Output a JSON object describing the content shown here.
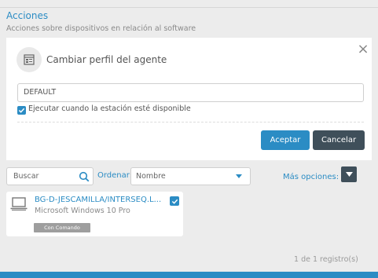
{
  "section": {
    "title": "Acciones",
    "subtitle": "Acciones sobre dispositivos en relación al software"
  },
  "dialog": {
    "title": "Cambiar perfil del agente",
    "close_icon": "close-icon",
    "profile_value": "DEFAULT",
    "checkbox_checked": true,
    "checkbox_label": "Ejecutar cuando la estación esté disponible",
    "accept_label": "Aceptar",
    "cancel_label": "Cancelar"
  },
  "toolbar": {
    "search_placeholder": "Buscar",
    "order_label": "Ordenar:",
    "order_value": "Nombre",
    "more_options_label": "Más opciones:"
  },
  "devices": [
    {
      "name": "BG-D-JESCAMILLA/INTERSEQ.L...",
      "os": "Microsoft Windows 10 Pro",
      "badge": "Con Comando",
      "selected": true
    }
  ],
  "pagination": {
    "text": "1 de 1 registro(s)"
  },
  "colors": {
    "accent": "#2b8cc4",
    "dark": "#3f4f5a",
    "background": "#ececec"
  }
}
